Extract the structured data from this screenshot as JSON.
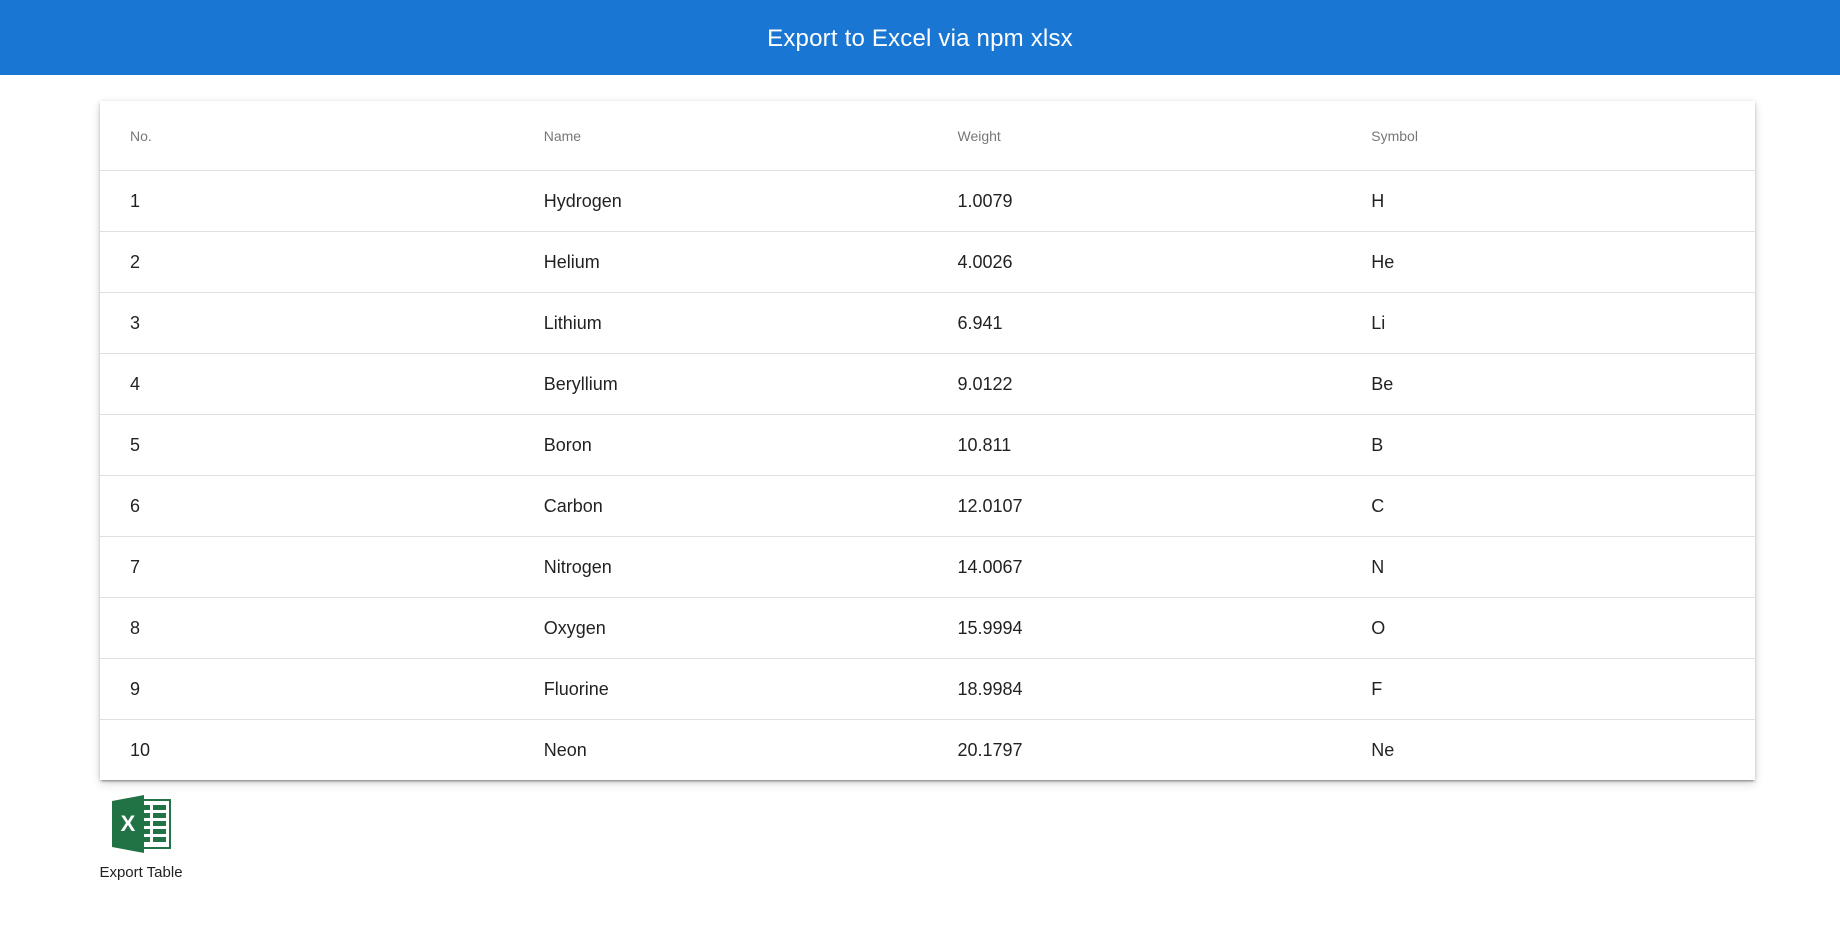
{
  "header": {
    "title": "Export to Excel via npm xlsx"
  },
  "table": {
    "columns": [
      "No.",
      "Name",
      "Weight",
      "Symbol"
    ],
    "rows": [
      [
        "1",
        "Hydrogen",
        "1.0079",
        "H"
      ],
      [
        "2",
        "Helium",
        "4.0026",
        "He"
      ],
      [
        "3",
        "Lithium",
        "6.941",
        "Li"
      ],
      [
        "4",
        "Beryllium",
        "9.0122",
        "Be"
      ],
      [
        "5",
        "Boron",
        "10.811",
        "B"
      ],
      [
        "6",
        "Carbon",
        "12.0107",
        "C"
      ],
      [
        "7",
        "Nitrogen",
        "14.0067",
        "N"
      ],
      [
        "8",
        "Oxygen",
        "15.9994",
        "O"
      ],
      [
        "9",
        "Fluorine",
        "18.9984",
        "F"
      ],
      [
        "10",
        "Neon",
        "20.1797",
        "Ne"
      ]
    ]
  },
  "export": {
    "label": "Export Table",
    "icon": "excel-icon",
    "icon_letter": "X"
  },
  "colors": {
    "app_bar": "#1976d2",
    "excel_green": "#217346"
  }
}
